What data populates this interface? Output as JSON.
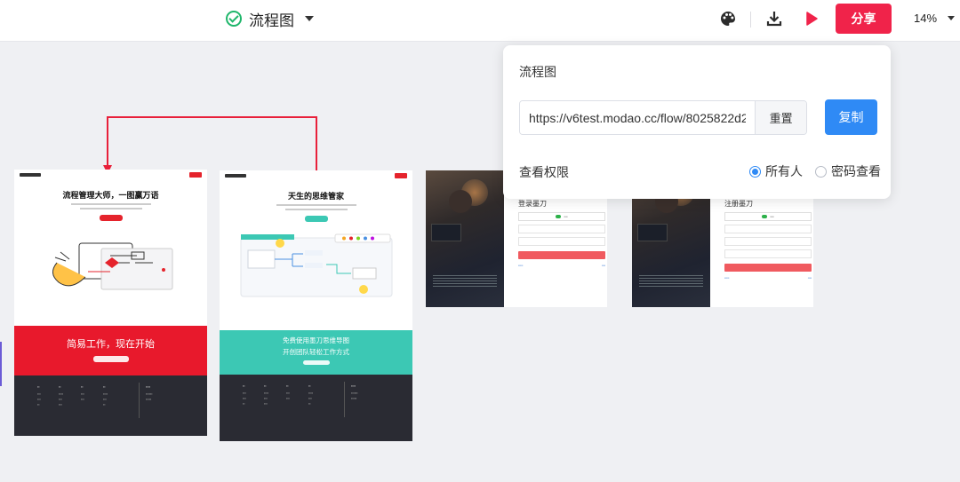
{
  "header": {
    "doc_title": "流程图",
    "share_label": "分享",
    "zoom": "14%",
    "icons": [
      "saved-check-icon",
      "title-dropdown-icon",
      "palette-icon",
      "download-icon",
      "present-play-icon",
      "zoom-dropdown-icon"
    ]
  },
  "share_panel": {
    "title": "流程图",
    "link": "https://v6test.modao.cc/flow/8025822d2",
    "reset_label": "重置",
    "copy_label": "复制",
    "permission_label": "查看权限",
    "options": [
      "所有人",
      "密码查看"
    ],
    "selected": "所有人"
  },
  "canvas": {
    "page1": {
      "heading": "流程管理大师，一图赢万语",
      "band_text": "简易工作，现在开始"
    },
    "page2": {
      "heading": "天生的思维管家",
      "band_line1": "免费使用墨刀思维导图",
      "band_line2": "开创团队轻松工作方式"
    },
    "page3": {
      "form_title": "登录墨刀"
    },
    "page4": {
      "form_title": "注册墨刀"
    }
  },
  "colors": {
    "brand_red": "#f0234a",
    "primary_blue": "#2f8af5",
    "connector_red": "#e8203a",
    "band_teal": "#3cc8b4"
  }
}
